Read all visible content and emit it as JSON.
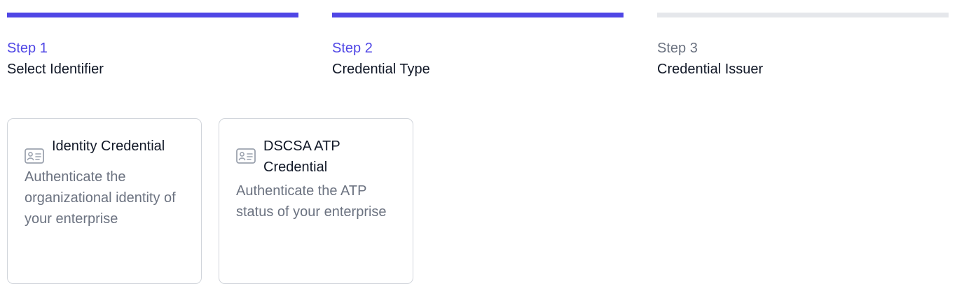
{
  "steps": [
    {
      "number": "Step 1",
      "name": "Select Identifier",
      "status": "complete"
    },
    {
      "number": "Step 2",
      "name": "Credential Type",
      "status": "current"
    },
    {
      "number": "Step 3",
      "name": "Credential Issuer",
      "status": "upcoming"
    }
  ],
  "cards": [
    {
      "icon": "id-card-icon",
      "title": "Identity Credential",
      "description": "Authenticate the organizational identity of your enterprise"
    },
    {
      "icon": "id-card-icon",
      "title": "DSCSA ATP Credential",
      "description": "Authenticate the ATP status of your enterprise"
    }
  ],
  "colors": {
    "accent": "#4f46e5",
    "inactive_bar": "#e5e7eb",
    "muted_text": "#6b7280",
    "card_border": "#d1d5db"
  }
}
